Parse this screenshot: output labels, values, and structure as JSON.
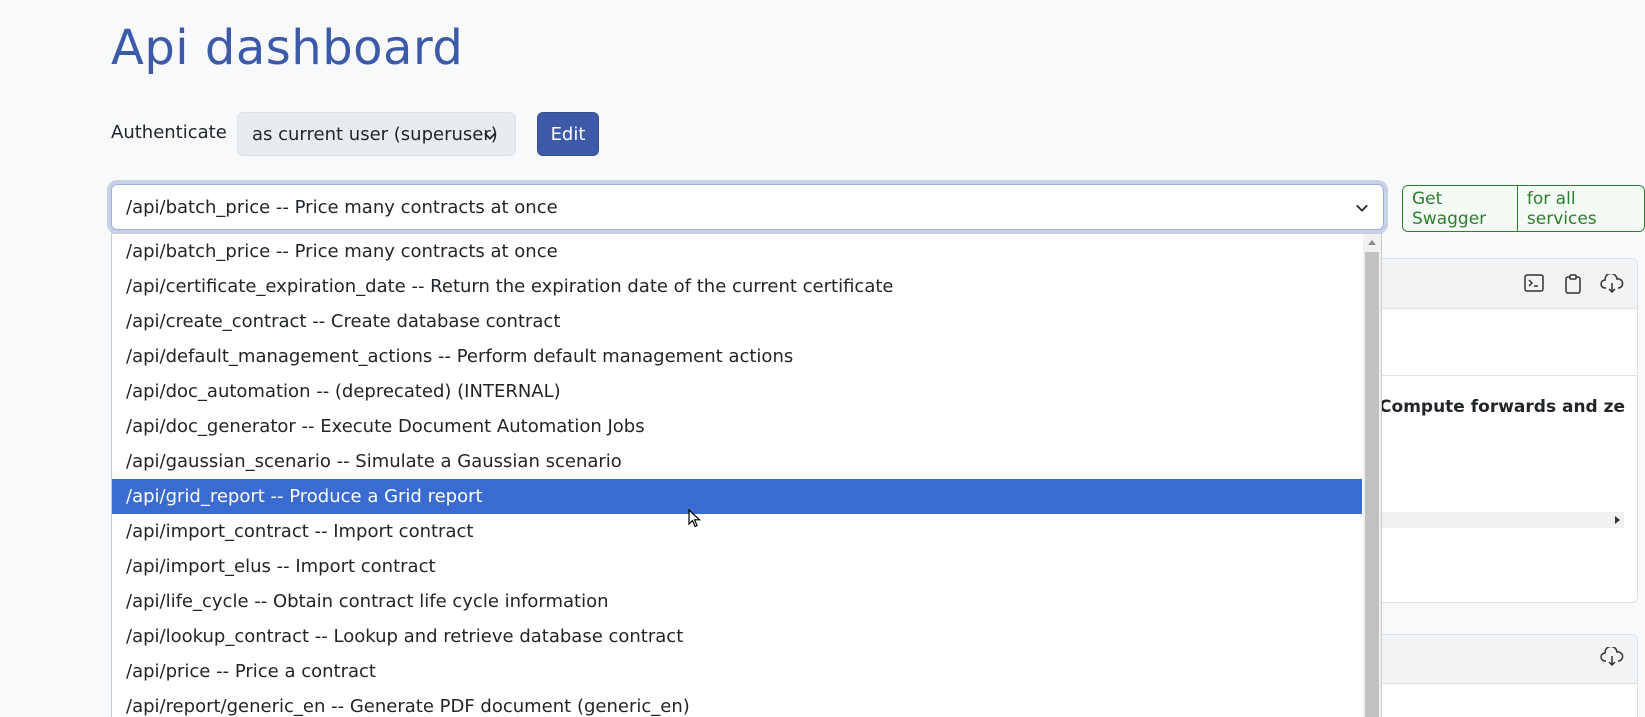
{
  "header": {
    "title": "Api dashboard"
  },
  "auth": {
    "label": "Authenticate",
    "selected": "as current user (superuser)",
    "edit_label": "Edit"
  },
  "api_select": {
    "selected": "/api/batch_price -- Price many contracts at once"
  },
  "swagger": {
    "get_label": "Get Swagger",
    "all_label": "for all services"
  },
  "background_card": {
    "visible_text": "s  Compute forwards and ze"
  },
  "dropdown": {
    "selected_index": 7,
    "options": [
      "/api/batch_price -- Price many contracts at once",
      "/api/certificate_expiration_date -- Return the expiration date of the current certificate",
      "/api/create_contract -- Create database contract",
      "/api/default_management_actions -- Perform default management actions",
      "/api/doc_automation -- (deprecated) (INTERNAL)",
      "/api/doc_generator -- Execute Document Automation Jobs",
      "/api/gaussian_scenario -- Simulate a Gaussian scenario",
      "/api/grid_report -- Produce a Grid report",
      "/api/import_contract -- Import contract",
      "/api/import_elus -- Import contract",
      "/api/life_cycle -- Obtain contract life cycle information",
      "/api/lookup_contract -- Lookup and retrieve database contract",
      "/api/price -- Price a contract",
      "/api/report/generic_en -- Generate PDF document (generic_en)"
    ]
  },
  "icons": {
    "terminal": "terminal-icon",
    "clipboard": "clipboard-icon",
    "download": "cloud-download-icon",
    "chevron": "chevron-down-icon"
  },
  "colors": {
    "title": "#3d5aa8",
    "edit_button": "#3d5aa8",
    "selected_option": "#3a6bd1",
    "swagger_green": "#2e7d32"
  }
}
